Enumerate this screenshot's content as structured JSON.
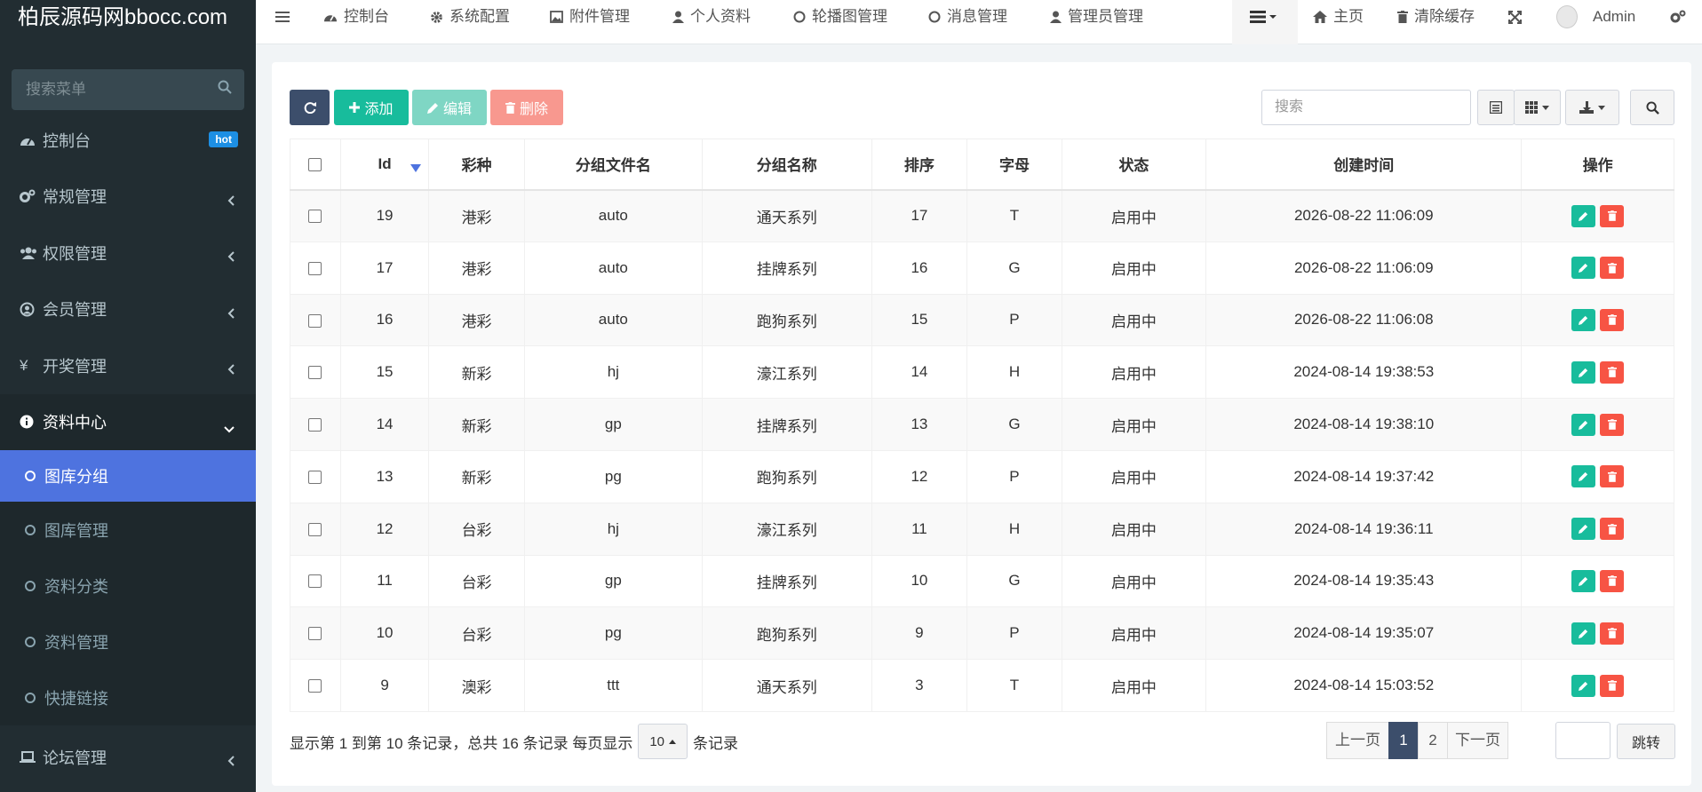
{
  "app": {
    "logo": "柏辰源码网bbocc.com"
  },
  "sidebar": {
    "search_placeholder": "搜索菜单",
    "items": [
      {
        "label": "控制台",
        "icon": "dashboard-icon",
        "badge": "hot"
      },
      {
        "label": "常规管理",
        "icon": "cogs-icon"
      },
      {
        "label": "权限管理",
        "icon": "users-icon"
      },
      {
        "label": "会员管理",
        "icon": "user-circle-icon"
      },
      {
        "label": "开奖管理",
        "icon": "yen-icon"
      },
      {
        "label": "资料中心",
        "icon": "info-circle-icon"
      }
    ],
    "subitems": [
      {
        "label": "图库分组"
      },
      {
        "label": "图库管理"
      },
      {
        "label": "资料分类"
      },
      {
        "label": "资料管理"
      },
      {
        "label": "快捷链接"
      }
    ],
    "last_item": {
      "label": "论坛管理",
      "icon": "laptop-icon"
    }
  },
  "topnav": {
    "tabs": [
      {
        "label": "控制台",
        "icon": "dashboard-icon"
      },
      {
        "label": "系统配置",
        "icon": "gear-icon"
      },
      {
        "label": "附件管理",
        "icon": "image-icon"
      },
      {
        "label": "个人资料",
        "icon": "user-icon"
      },
      {
        "label": "轮播图管理",
        "icon": "circle-icon"
      },
      {
        "label": "消息管理",
        "icon": "circle-icon"
      },
      {
        "label": "管理员管理",
        "icon": "user-icon"
      }
    ],
    "home": "主页",
    "clear_cache": "清除缓存",
    "admin_name": "Admin"
  },
  "toolbar": {
    "add": "添加",
    "edit": "编辑",
    "delete": "删除",
    "search_placeholder": "搜索"
  },
  "table": {
    "columns": [
      "Id",
      "彩种",
      "分组文件名",
      "分组名称",
      "排序",
      "字母",
      "状态",
      "创建时间",
      "操作"
    ],
    "rows": [
      {
        "id": "19",
        "lottery": "港彩",
        "file": "auto",
        "name": "通天系列",
        "sort": "17",
        "letter": "T",
        "status": "启用中",
        "created": "2026-08-22 11:06:09"
      },
      {
        "id": "17",
        "lottery": "港彩",
        "file": "auto",
        "name": "挂牌系列",
        "sort": "16",
        "letter": "G",
        "status": "启用中",
        "created": "2026-08-22 11:06:09"
      },
      {
        "id": "16",
        "lottery": "港彩",
        "file": "auto",
        "name": "跑狗系列",
        "sort": "15",
        "letter": "P",
        "status": "启用中",
        "created": "2026-08-22 11:06:08"
      },
      {
        "id": "15",
        "lottery": "新彩",
        "file": "hj",
        "name": "濠江系列",
        "sort": "14",
        "letter": "H",
        "status": "启用中",
        "created": "2024-08-14 19:38:53"
      },
      {
        "id": "14",
        "lottery": "新彩",
        "file": "gp",
        "name": "挂牌系列",
        "sort": "13",
        "letter": "G",
        "status": "启用中",
        "created": "2024-08-14 19:38:10"
      },
      {
        "id": "13",
        "lottery": "新彩",
        "file": "pg",
        "name": "跑狗系列",
        "sort": "12",
        "letter": "P",
        "status": "启用中",
        "created": "2024-08-14 19:37:42"
      },
      {
        "id": "12",
        "lottery": "台彩",
        "file": "hj",
        "name": "濠江系列",
        "sort": "11",
        "letter": "H",
        "status": "启用中",
        "created": "2024-08-14 19:36:11"
      },
      {
        "id": "11",
        "lottery": "台彩",
        "file": "gp",
        "name": "挂牌系列",
        "sort": "10",
        "letter": "G",
        "status": "启用中",
        "created": "2024-08-14 19:35:43"
      },
      {
        "id": "10",
        "lottery": "台彩",
        "file": "pg",
        "name": "跑狗系列",
        "sort": "9",
        "letter": "P",
        "status": "启用中",
        "created": "2024-08-14 19:35:07"
      },
      {
        "id": "9",
        "lottery": "澳彩",
        "file": "ttt",
        "name": "通天系列",
        "sort": "3",
        "letter": "T",
        "status": "启用中",
        "created": "2024-08-14 15:03:52"
      }
    ]
  },
  "footer": {
    "info_prefix": "显示第 1 到第 10 条记录，总共 16 条记录 每页显示",
    "page_size": "10",
    "info_suffix": "条记录",
    "prev": "上一页",
    "pages": [
      "1",
      "2"
    ],
    "next": "下一页",
    "jump": "跳转"
  },
  "colors": {
    "sidebar_bg": "#222d32",
    "active_menu": "#4e73df",
    "add": "#18bc9c",
    "edit": "#7fd6c4",
    "delete": "#f8988f",
    "refresh": "#3c4e6b",
    "status": "#18bc9c"
  }
}
